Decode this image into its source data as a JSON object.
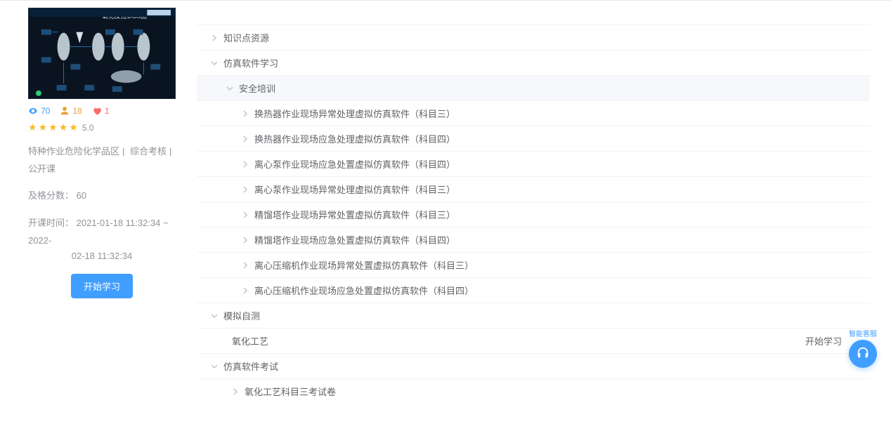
{
  "sidebar": {
    "thumb_caption": "氧化反应DCS图",
    "views": "70",
    "users": "18",
    "likes": "1",
    "rating_score": "5.0",
    "tags": [
      "特种作业危险化学品区",
      "综合考核",
      "公开课"
    ],
    "pass_label": "及格分数：",
    "pass_score": "60",
    "time_label": "开课时间：",
    "time_range_a": "2021-01-18 11:32:34 ~ 2022-",
    "time_range_b": "02-18 11:32:34",
    "start_btn": "开始学习"
  },
  "tree": {
    "n_knowledge": "知识点资源",
    "n_sim_learn": "仿真软件学习",
    "n_safety": "安全培训",
    "items": [
      "换热器作业现场异常处理虚拟仿真软件（科目三）",
      "换热器作业现场应急处理虚拟仿真软件（科目四）",
      "离心泵作业现场应急处置虚拟仿真软件（科目四）",
      "离心泵作业现场异常处理虚拟仿真软件（科目三）",
      "精馏塔作业现场异常处置虚拟仿真软件（科目三）",
      "精馏塔作业现场应急处置虚拟仿真软件（科目四）",
      "离心压缩机作业现场异常处置虚拟仿真软件（科目三）",
      "离心压缩机作业现场应急处置虚拟仿真软件（科目四）"
    ],
    "n_mock": "模拟自测",
    "mock_item": "氧化工艺",
    "mock_action": "开始学习",
    "n_exam": "仿真软件考试",
    "exam_item": "氧化工艺科目三考试卷"
  },
  "assistant_label": "智能客服"
}
